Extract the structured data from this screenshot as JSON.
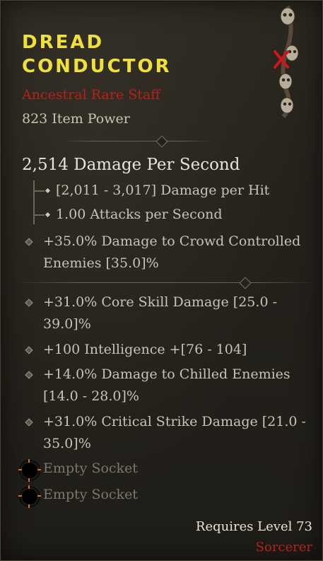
{
  "item": {
    "name_line1": "DREAD",
    "name_line2": "CONDUCTOR",
    "rarity": "Ancestral Rare Staff",
    "item_power": "823 Item Power",
    "icon": "skull-staff-icon"
  },
  "weapon": {
    "dps": "2,514 Damage Per Second",
    "damage_per_hit": "[2,011 - 3,017] Damage per Hit",
    "attacks_per_second": "1.00 Attacks per Second"
  },
  "implicit": {
    "line1": "+35.0% Damage to Crowd Controlled",
    "line2": "Enemies [35.0]%"
  },
  "affixes": [
    {
      "line1": "+31.0% Core Skill Damage [25.0 -",
      "line2": "39.0]%"
    },
    {
      "line1": "+100 Intelligence +[76 - 104]",
      "line2": ""
    },
    {
      "line1": "+14.0% Damage to Chilled Enemies",
      "line2": "[14.0 - 28.0]%"
    },
    {
      "line1": "+31.0% Critical Strike Damage [21.0 -",
      "line2": "35.0]%"
    }
  ],
  "sockets": [
    {
      "label": "Empty Socket"
    },
    {
      "label": "Empty Socket"
    }
  ],
  "requirements": {
    "level": "Requires Level 73",
    "class": "Sorcerer"
  },
  "colors": {
    "title": "#f0e13a",
    "rarity": "#b5221c",
    "text": "#c8c3b6",
    "socket_accent": "#d56b2f"
  }
}
